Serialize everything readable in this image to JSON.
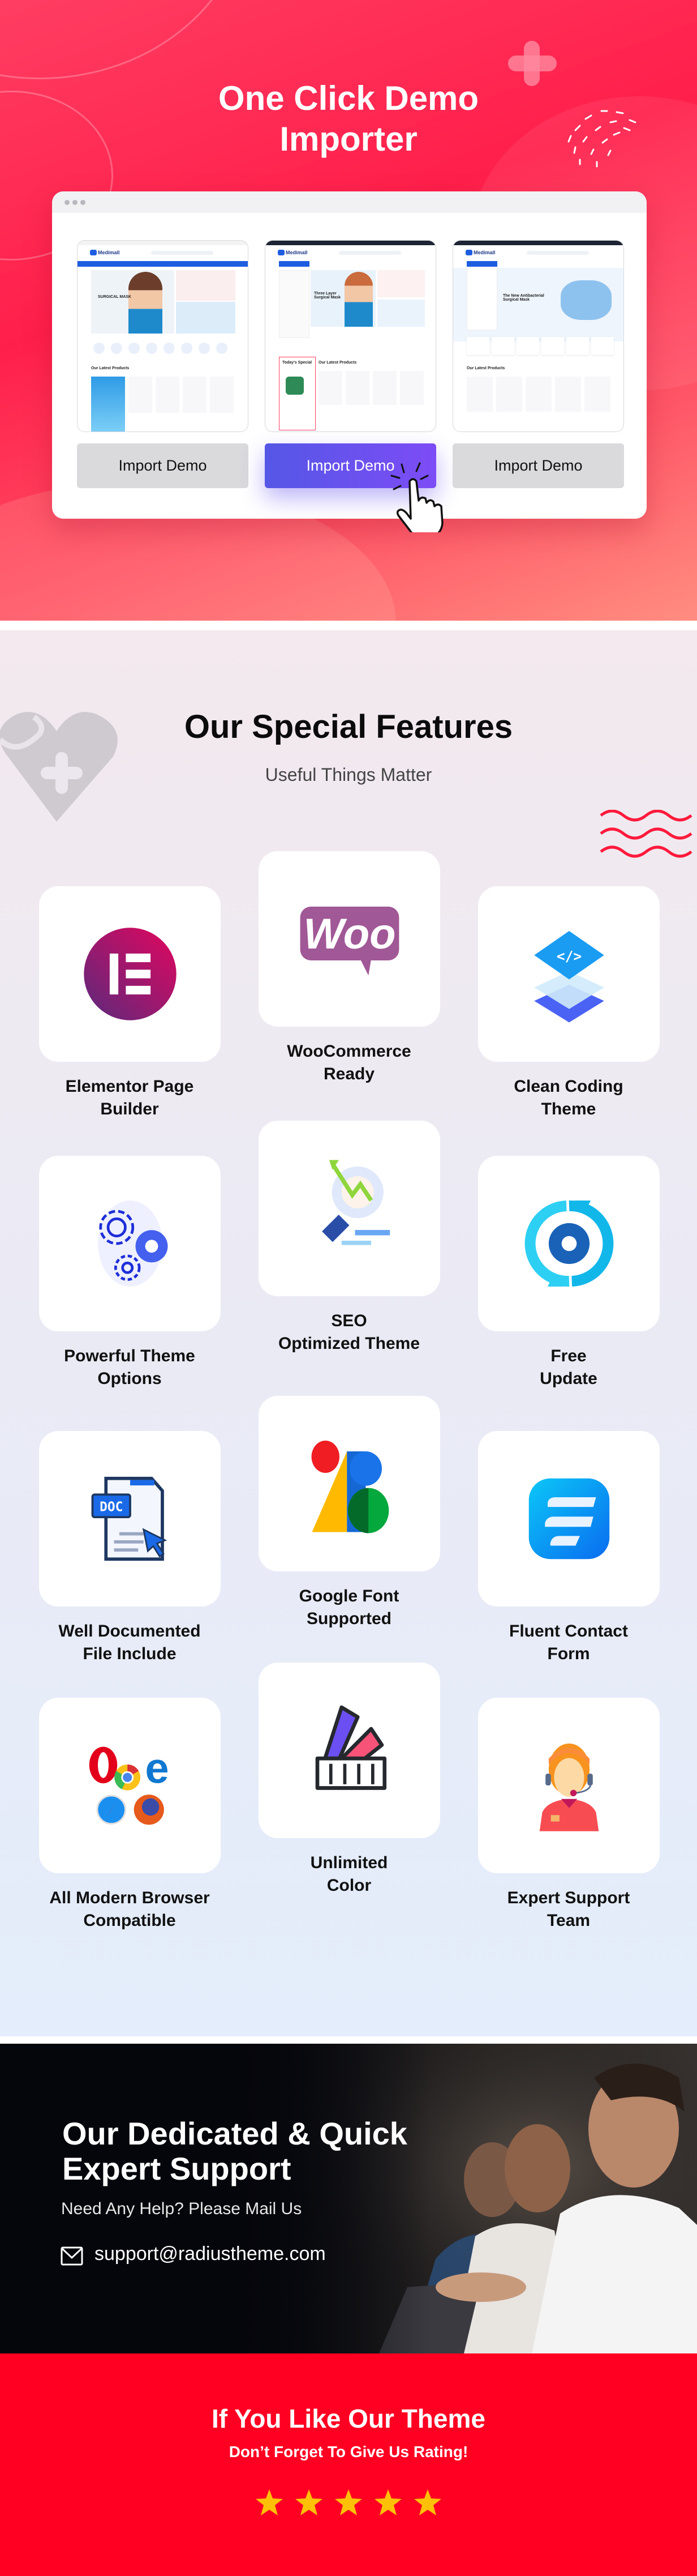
{
  "hero": {
    "title_line1": "One Click Demo",
    "title_line2": "Importer",
    "demos": [
      {
        "brand": "Medimall",
        "headline": "SURGICAL MASK",
        "section": "Our Latest Products",
        "button": "Import Demo",
        "active": false
      },
      {
        "brand": "Medimall",
        "headline": "Three Layer Surgical Mask",
        "section": "Our Latest Products",
        "side": "Today's Special",
        "button": "Import Demo",
        "active": true
      },
      {
        "brand": "Medimall",
        "headline": "The New Antibacterial Surgical Mask",
        "section": "Our Latest Products",
        "button": "Import Demo",
        "active": false
      }
    ],
    "colors": {
      "accent": "#ff1f4b",
      "button_active": "#6a52f0"
    }
  },
  "features": {
    "title": "Our Special Features",
    "subtitle": "Useful Things Matter",
    "items": [
      {
        "icon": "elementor-icon",
        "lines": [
          "Elementor Page",
          "Builder"
        ]
      },
      {
        "icon": "woocommerce-icon",
        "logo_text": "Woo",
        "lines": [
          "WooCommerce",
          "Ready"
        ]
      },
      {
        "icon": "code-layers-icon",
        "lines": [
          "Clean Coding",
          "Theme"
        ]
      },
      {
        "icon": "gears-icon",
        "lines": [
          "Powerful Theme",
          "Options"
        ]
      },
      {
        "icon": "seo-magnifier-icon",
        "lines": [
          "SEO",
          "Optimized Theme"
        ]
      },
      {
        "icon": "update-icon",
        "lines": [
          "Free",
          "Update"
        ]
      },
      {
        "icon": "doc-file-icon",
        "logo_text": "DOC",
        "lines": [
          "Well Documented",
          "File Include"
        ]
      },
      {
        "icon": "google-fonts-icon",
        "lines": [
          "Google Font",
          "Supported"
        ]
      },
      {
        "icon": "fluent-forms-icon",
        "lines": [
          "Fluent Contact",
          "Form"
        ]
      },
      {
        "icon": "browsers-icon",
        "lines": [
          "All Modern Browser",
          "Compatible"
        ]
      },
      {
        "icon": "color-swatch-icon",
        "lines": [
          "Unlimited",
          "Color"
        ]
      },
      {
        "icon": "support-agent-icon",
        "lines": [
          "Expert Support",
          "Team"
        ]
      }
    ]
  },
  "support": {
    "title_line1": "Our Dedicated & Quick",
    "title_line2": "Expert Support",
    "subtitle": "Need Any Help? Please Mail Us",
    "email": "support@radiustheme.com"
  },
  "rating": {
    "title": "If You Like Our Theme",
    "subtitle": "Don’t Forget To Give Us Rating!",
    "stars": 5,
    "star_color": "#ffc107",
    "bg_color": "#ff0022"
  }
}
